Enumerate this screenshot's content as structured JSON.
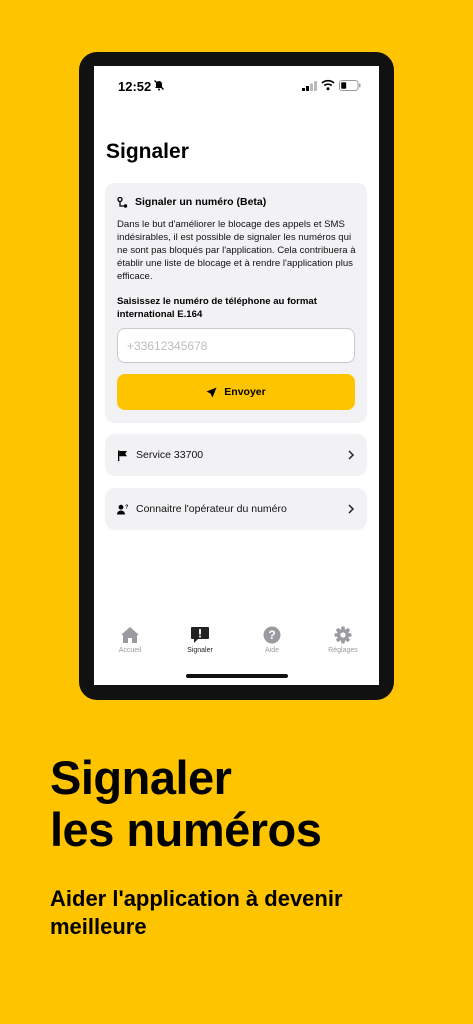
{
  "status_bar": {
    "time": "12:52"
  },
  "page": {
    "title": "Signaler"
  },
  "report_card": {
    "title": "Signaler un numéro (Beta)",
    "description": "Dans le but d'améliorer le blocage des appels et SMS indésirables, il est possible de signaler les numéros qui ne sont pas bloqués par l'application. Cela contribuera à établir une liste de blocage et à rendre l'application plus efficace.",
    "input_label": "Saisissez le numéro de téléphone au format international E.164",
    "input_value": "",
    "input_placeholder": "+33612345678",
    "send_label": "Envoyer"
  },
  "rows": [
    {
      "label": "Service 33700",
      "icon": "flag-icon"
    },
    {
      "label": "Connaitre l'opérateur du numéro",
      "icon": "user-question-icon"
    }
  ],
  "tabs": [
    {
      "label": "Accueil",
      "icon": "home-icon",
      "active": false
    },
    {
      "label": "Signaler",
      "icon": "report-icon",
      "active": true
    },
    {
      "label": "Aide",
      "icon": "help-icon",
      "active": false
    },
    {
      "label": "Réglages",
      "icon": "gear-icon",
      "active": false
    }
  ],
  "promo": {
    "headline_line1": "Signaler",
    "headline_line2": "les numéros",
    "subline": "Aider l'application à devenir meilleure"
  },
  "colors": {
    "accent": "#FFC400",
    "card": "#F2F2F5",
    "inactive_tab": "#9A9AA0"
  }
}
